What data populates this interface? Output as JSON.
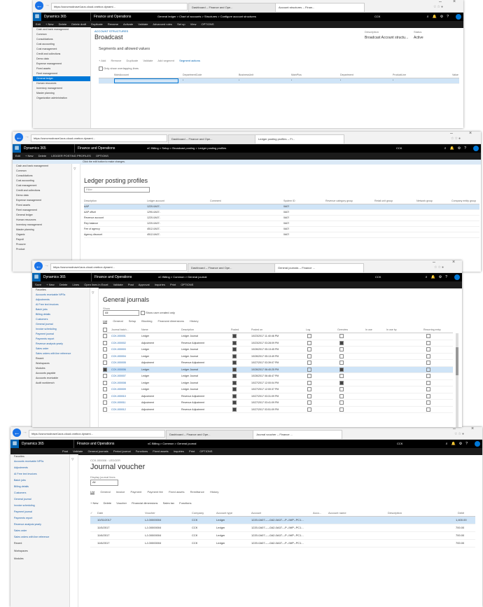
{
  "window1": {
    "url": "https://usncmodnave1aos.cloud.onebox.dynami...",
    "tabs": [
      "Dashboard -- Finance and Ope...",
      "Account structures -- Finan..."
    ],
    "app": "Dynamics 365",
    "module": "Finance and Operations",
    "breadcrumb": "General ledger  >  Chart of accounts  >  Structures  >  Configure account structures",
    "company": "CCK",
    "actions": [
      "Edit",
      "+ New",
      "Delete",
      "Delete draft",
      "Duplicate",
      "Rename",
      "Activate",
      "Validate",
      "Advanced rules",
      "Set up",
      "View",
      "OPTIONS"
    ],
    "nav": [
      "Cash and bank management",
      "Common",
      "Consolidations",
      "Cost accounting",
      "Cost management",
      "Credit and collections",
      "Demo data",
      "Expense management",
      "Fixed assets",
      "Fleet management",
      "General ledger",
      "Human resources",
      "Inventory management",
      "Master planning",
      "Organization administration"
    ],
    "nav_selected": 10,
    "section": "ACCOUNT STRUCTURES",
    "title": "Broadcast",
    "desc_label": "Description",
    "desc_value": "Broadcast Account structu...",
    "status_label": "Status",
    "status_value": "Active",
    "panel_title": "Segments and allowed values",
    "panel_tools": [
      "+ Add",
      "Remove",
      "Duplicate",
      "Validate",
      "Add segment",
      "Segment actions"
    ],
    "show_overlapping": "Only show overlapping lines",
    "columns": [
      "MainAccount",
      "DepartmentCode",
      "BusinessUnit",
      "MainPlus",
      "Department",
      "ProductLine",
      "Value"
    ],
    "row_values": [
      "",
      "*",
      "*",
      "*",
      "*",
      "*",
      ""
    ]
  },
  "window2": {
    "url": "https://usncmodnave1aos.cloud.onebox.dynami...",
    "tabs": [
      "Dashboard -- Finance and Ope...",
      "Ledger posting profiles -- Fi..."
    ],
    "app": "Dynamics 365",
    "module": "Finance and Operations",
    "breadcrumb": "xC Billing  >  Setup  >  Broadcast posting  >  Ledger posting profiles",
    "company": "CCK",
    "actions": [
      "Edit",
      "+ New",
      "Delete",
      "LEDGER POSTING PROFILES",
      "OPTIONS"
    ],
    "infobar": "Click the edit button to make changes.",
    "nav": [
      "Cash and bank management",
      "Common",
      "Consolidations",
      "Cost accounting",
      "Cost management",
      "Credit and collections",
      "Demo data",
      "Expense management",
      "Fixed assets",
      "Fleet management",
      "General ledger",
      "Human resources",
      "Inventory management",
      "Master planning",
      "Organiz",
      "Payroll",
      "Procurer",
      "Product"
    ],
    "title": "Ledger posting profiles",
    "filter_placeholder": "Filter",
    "columns": [
      "Description",
      "Ledger account",
      "Comment",
      "System ID",
      "Revenue category group",
      "Retail unit group",
      "Network group",
      "Company entity group"
    ],
    "rows": [
      {
        "desc": "AAP",
        "account": "1220-0A07-",
        "sysid": "0A07"
      },
      {
        "desc": "AAP offset",
        "account": "1290-0A07-",
        "sysid": "0A07"
      },
      {
        "desc": "Revenue account",
        "account": "1220-0A07-",
        "sysid": "0A07"
      },
      {
        "desc": "Rep balance",
        "account": "1220-0A07-",
        "sysid": "0A07"
      },
      {
        "desc": "Fee of agency",
        "account": "4512-0A07-",
        "sysid": "0A07"
      },
      {
        "desc": "Agency discount",
        "account": "4512-0A07-",
        "sysid": "0A07"
      }
    ]
  },
  "window3": {
    "url": "https://usncmodnave1aos.cloud.onebox.dynami...",
    "tabs": [
      "Dashboard -- Finance and Ope...",
      "General journals -- Finance ..."
    ],
    "app": "Dynamics 365",
    "module": "Finance and Operations",
    "breadcrumb": "xC Billing  >  Common  >  General journal",
    "company": "CCK",
    "actions": [
      "Save",
      "+ New",
      "Delete",
      "Lines",
      "Open lines in Excel",
      "Validate",
      "Post",
      "Approval",
      "Inquiries",
      "Print",
      "OPTIONS"
    ],
    "nav_header": "Favorites",
    "nav": [
      "Accounts receivable NPSs",
      "Adjustments",
      "AI Free text invoices",
      "Batch jobs",
      "Billing details",
      "Customers",
      "General journal",
      "Invoice scheduling",
      "Payment journal",
      "Payments report",
      "Revenue analysis yearly",
      "Sales order",
      "Sales orders with line reference",
      "Recent",
      "Workspaces",
      "Modules",
      "Accounts payable",
      "Accounts receivable",
      "Audit workbench"
    ],
    "title": "General journals",
    "show_label": "Show",
    "show_value": "All",
    "show_user_created": "Show user created only",
    "subtabs": [
      "List",
      "General",
      "Setup",
      "Blocking",
      "Financial dimensions",
      "History"
    ],
    "columns": [
      "Journal batch...",
      "Name",
      "Description",
      "Posted",
      "Posted on",
      "Log",
      "Overview",
      "In use",
      "In use by",
      "Recurring entry"
    ],
    "rows": [
      {
        "batch": "CCK-000001",
        "name": "Ledger",
        "desc": "Ledger Journal",
        "posted": true,
        "on": "10/23/2017 11:40:46 PM",
        "ov": false
      },
      {
        "batch": "CCK-000002",
        "name": "Adjustment",
        "desc": "Revenue Adjustment",
        "posted": true,
        "on": "10/23/2017 03:28:09 PM",
        "ov": true
      },
      {
        "batch": "CCK-000003",
        "name": "Ledger",
        "desc": "Ledger Journal",
        "posted": true,
        "on": "10/26/2017 05:13:45 PM",
        "ov": false
      },
      {
        "batch": "CCK-000004",
        "name": "Ledger",
        "desc": "Ledger Journal",
        "posted": true,
        "on": "10/26/2017 05:13:49 PM",
        "ov": false
      },
      {
        "batch": "CCK-000005",
        "name": "Adjustment",
        "desc": "Revenue Adjustment",
        "posted": true,
        "on": "10/27/2017 03:39:07 PM",
        "ov": false
      },
      {
        "batch": "CCK-000006",
        "name": "Ledger",
        "desc": "Ledger Journal",
        "posted": true,
        "on": "10/26/2017 06:40:25 PM",
        "ov": true,
        "sel": true
      },
      {
        "batch": "CCK-000007",
        "name": "Ledger",
        "desc": "Ledger Journal",
        "posted": true,
        "on": "10/26/2017 06:46:47 PM",
        "ov": false
      },
      {
        "batch": "CCK-000008",
        "name": "Ledger",
        "desc": "Ledger Journal",
        "posted": true,
        "on": "10/27/2017 12:00:04 PM",
        "ov": true
      },
      {
        "batch": "CCK-000009",
        "name": "Ledger",
        "desc": "Ledger Journal",
        "posted": true,
        "on": "10/27/2017 12:00:37 PM",
        "ov": false
      },
      {
        "batch": "CCK-000010",
        "name": "Adjustment",
        "desc": "Revenue Adjustment",
        "posted": true,
        "on": "10/27/2017 03:31:09 PM",
        "ov": false
      },
      {
        "batch": "CCK-000011",
        "name": "Adjustment",
        "desc": "Revenue Adjustment",
        "posted": true,
        "on": "10/27/2017 03:41:09 PM",
        "ov": false
      },
      {
        "batch": "CCK-000012",
        "name": "Adjustment",
        "desc": "Revenue Adjustment",
        "posted": true,
        "on": "10/27/2017 03:51:09 PM",
        "ov": false
      }
    ]
  },
  "window4": {
    "url": "https://usncmodnave1aos.cloud.onebox.dynami...",
    "tabs": [
      "Dashboard -- Finance and Ope...",
      "Journal voucher -- Finance ..."
    ],
    "app": "Dynamics 365",
    "module": "Finance and Operations",
    "breadcrumb": "xC Billing  >  Common  >  General journal",
    "company": "CCK",
    "actions": [
      "Post",
      "Validate",
      "General journals",
      "Period journal",
      "Functions",
      "Fixed assets",
      "Inquiries",
      "Print",
      "OPTIONS"
    ],
    "nav_header": "Favorites",
    "nav": [
      "Accounts receivable NPSs",
      "Adjustments",
      "AI Free text invoices",
      "Batch jobs",
      "Billing details",
      "Customers",
      "General journal",
      "Invoice scheduling",
      "Payment journal",
      "Payments report",
      "Revenue analysis yearly",
      "Sales order",
      "Sales orders with line reference",
      "Recent",
      "Workspaces",
      "Modules"
    ],
    "subtitle": "CCK-000006 : LEDGER",
    "title": "Journal voucher",
    "display_label": "Display journal lines",
    "display_value": "All",
    "subtabs": [
      "List",
      "General",
      "Invoice",
      "Payment",
      "Payment fee",
      "Fixed assets",
      "Remittance",
      "History"
    ],
    "toolbar": [
      "+ New",
      "Delete",
      "Voucher",
      "Financial dimensions",
      "Sales tax",
      "Functions"
    ],
    "columns": [
      "Date",
      "Voucher",
      "Company",
      "Account type",
      "Account",
      "Acco...",
      "Account name",
      "Description",
      "Debit"
    ],
    "rows": [
      {
        "date": "10/31/2017",
        "voucher": "LJ-00000004",
        "company": "CCK",
        "type": "Ledger",
        "account": "1220-0A07-----0A2-0A07---P--IWP--PC1...",
        "debit": "1,400.00",
        "sel": true
      },
      {
        "date": "11/5/2017",
        "voucher": "LJ-00000004",
        "company": "CCK",
        "type": "Ledger",
        "account": "1220-0A07-----0A2-0A07---P--IWP--PC1...",
        "debit": "700.00"
      },
      {
        "date": "11/6/2017",
        "voucher": "LJ-00000004",
        "company": "CCK",
        "type": "Ledger",
        "account": "1220-0A07-----0A2-0A07---P--IWP--PC1...",
        "debit": "700.00"
      },
      {
        "date": "11/6/2017",
        "voucher": "LJ-00000004",
        "company": "CCK",
        "type": "Ledger",
        "account": "1220-0A07-----0A2-0A07---P--IWP--PC1...",
        "debit": "700.00"
      }
    ]
  }
}
